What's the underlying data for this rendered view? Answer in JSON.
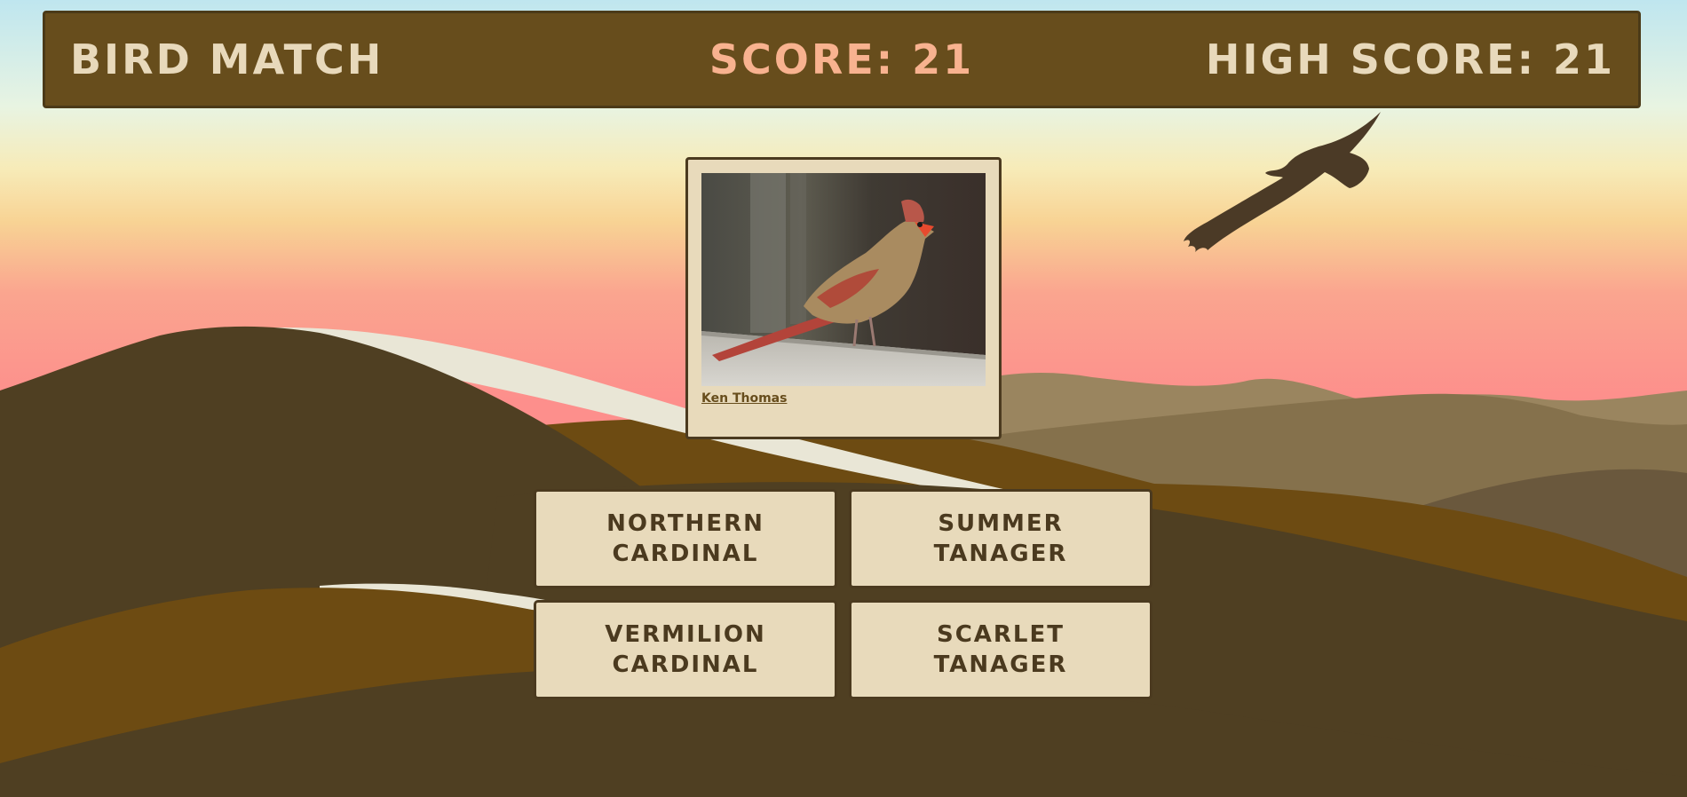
{
  "header": {
    "title": "BIRD MATCH",
    "score_label": "SCORE: 21",
    "high_score_label": "HIGH SCORE: 21"
  },
  "quiz": {
    "photo_subject": "bird-photo-female-cardinal",
    "photo_credit": "Ken Thomas",
    "choices": [
      {
        "label": "NORTHERN CARDINAL"
      },
      {
        "label": "SUMMER TANAGER"
      },
      {
        "label": "VERMILION CARDINAL"
      },
      {
        "label": "SCARLET TANAGER"
      }
    ]
  },
  "colors": {
    "header_bg": "#674d1c",
    "header_text": "#e8d9bb",
    "score_text": "#f8b28f",
    "card_bg": "#e8dabb",
    "card_text": "#4b3a1f",
    "ground_dark": "#4f3f22",
    "ground_mid": "#6d4b12"
  }
}
